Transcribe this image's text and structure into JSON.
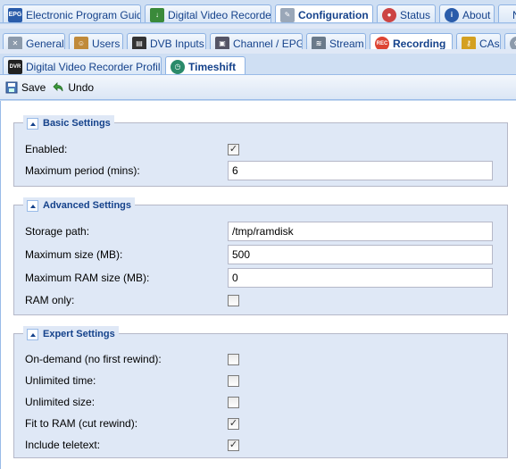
{
  "tabs_row1": [
    {
      "label": "Electronic Program Guide",
      "icon": "epg-icon",
      "active": false
    },
    {
      "label": "Digital Video Recorder",
      "icon": "dvr-icon",
      "active": false
    },
    {
      "label": "Configuration",
      "icon": "wrench-icon",
      "active": true
    },
    {
      "label": "Status",
      "icon": "eye-icon",
      "active": false
    },
    {
      "label": "About",
      "icon": "info-icon",
      "active": false
    },
    {
      "label": "N",
      "icon": "",
      "active": false
    }
  ],
  "tabs_row2": [
    {
      "label": "General",
      "icon": "tools-icon",
      "active": false
    },
    {
      "label": "Users",
      "icon": "users-icon",
      "active": false
    },
    {
      "label": "DVB Inputs",
      "icon": "film-icon",
      "active": false
    },
    {
      "label": "Channel / EPG",
      "icon": "tv-icon",
      "active": false
    },
    {
      "label": "Stream",
      "icon": "stream-icon",
      "active": false
    },
    {
      "label": "Recording",
      "icon": "rec-icon",
      "active": true
    },
    {
      "label": "CAs",
      "icon": "key-icon",
      "active": false
    }
  ],
  "tabs_row3": [
    {
      "label": "Digital Video Recorder Profiles",
      "icon": "dvr-profile-icon",
      "active": false
    },
    {
      "label": "Timeshift",
      "icon": "timeshift-icon",
      "active": true
    }
  ],
  "toolbar": {
    "save_label": "Save",
    "undo_label": "Undo"
  },
  "basic": {
    "legend": "Basic Settings",
    "enabled_label": "Enabled:",
    "enabled": true,
    "max_period_label": "Maximum period (mins):",
    "max_period": "6"
  },
  "advanced": {
    "legend": "Advanced Settings",
    "storage_path_label": "Storage path:",
    "storage_path": "/tmp/ramdisk",
    "max_size_label": "Maximum size (MB):",
    "max_size": "500",
    "max_ram_label": "Maximum RAM size (MB):",
    "max_ram": "0",
    "ram_only_label": "RAM only:",
    "ram_only": false
  },
  "expert": {
    "legend": "Expert Settings",
    "on_demand_label": "On-demand (no first rewind):",
    "on_demand": false,
    "unlimited_time_label": "Unlimited time:",
    "unlimited_time": false,
    "unlimited_size_label": "Unlimited size:",
    "unlimited_size": false,
    "fit_ram_label": "Fit to RAM (cut rewind):",
    "fit_ram": true,
    "teletext_label": "Include teletext:",
    "teletext": true
  }
}
